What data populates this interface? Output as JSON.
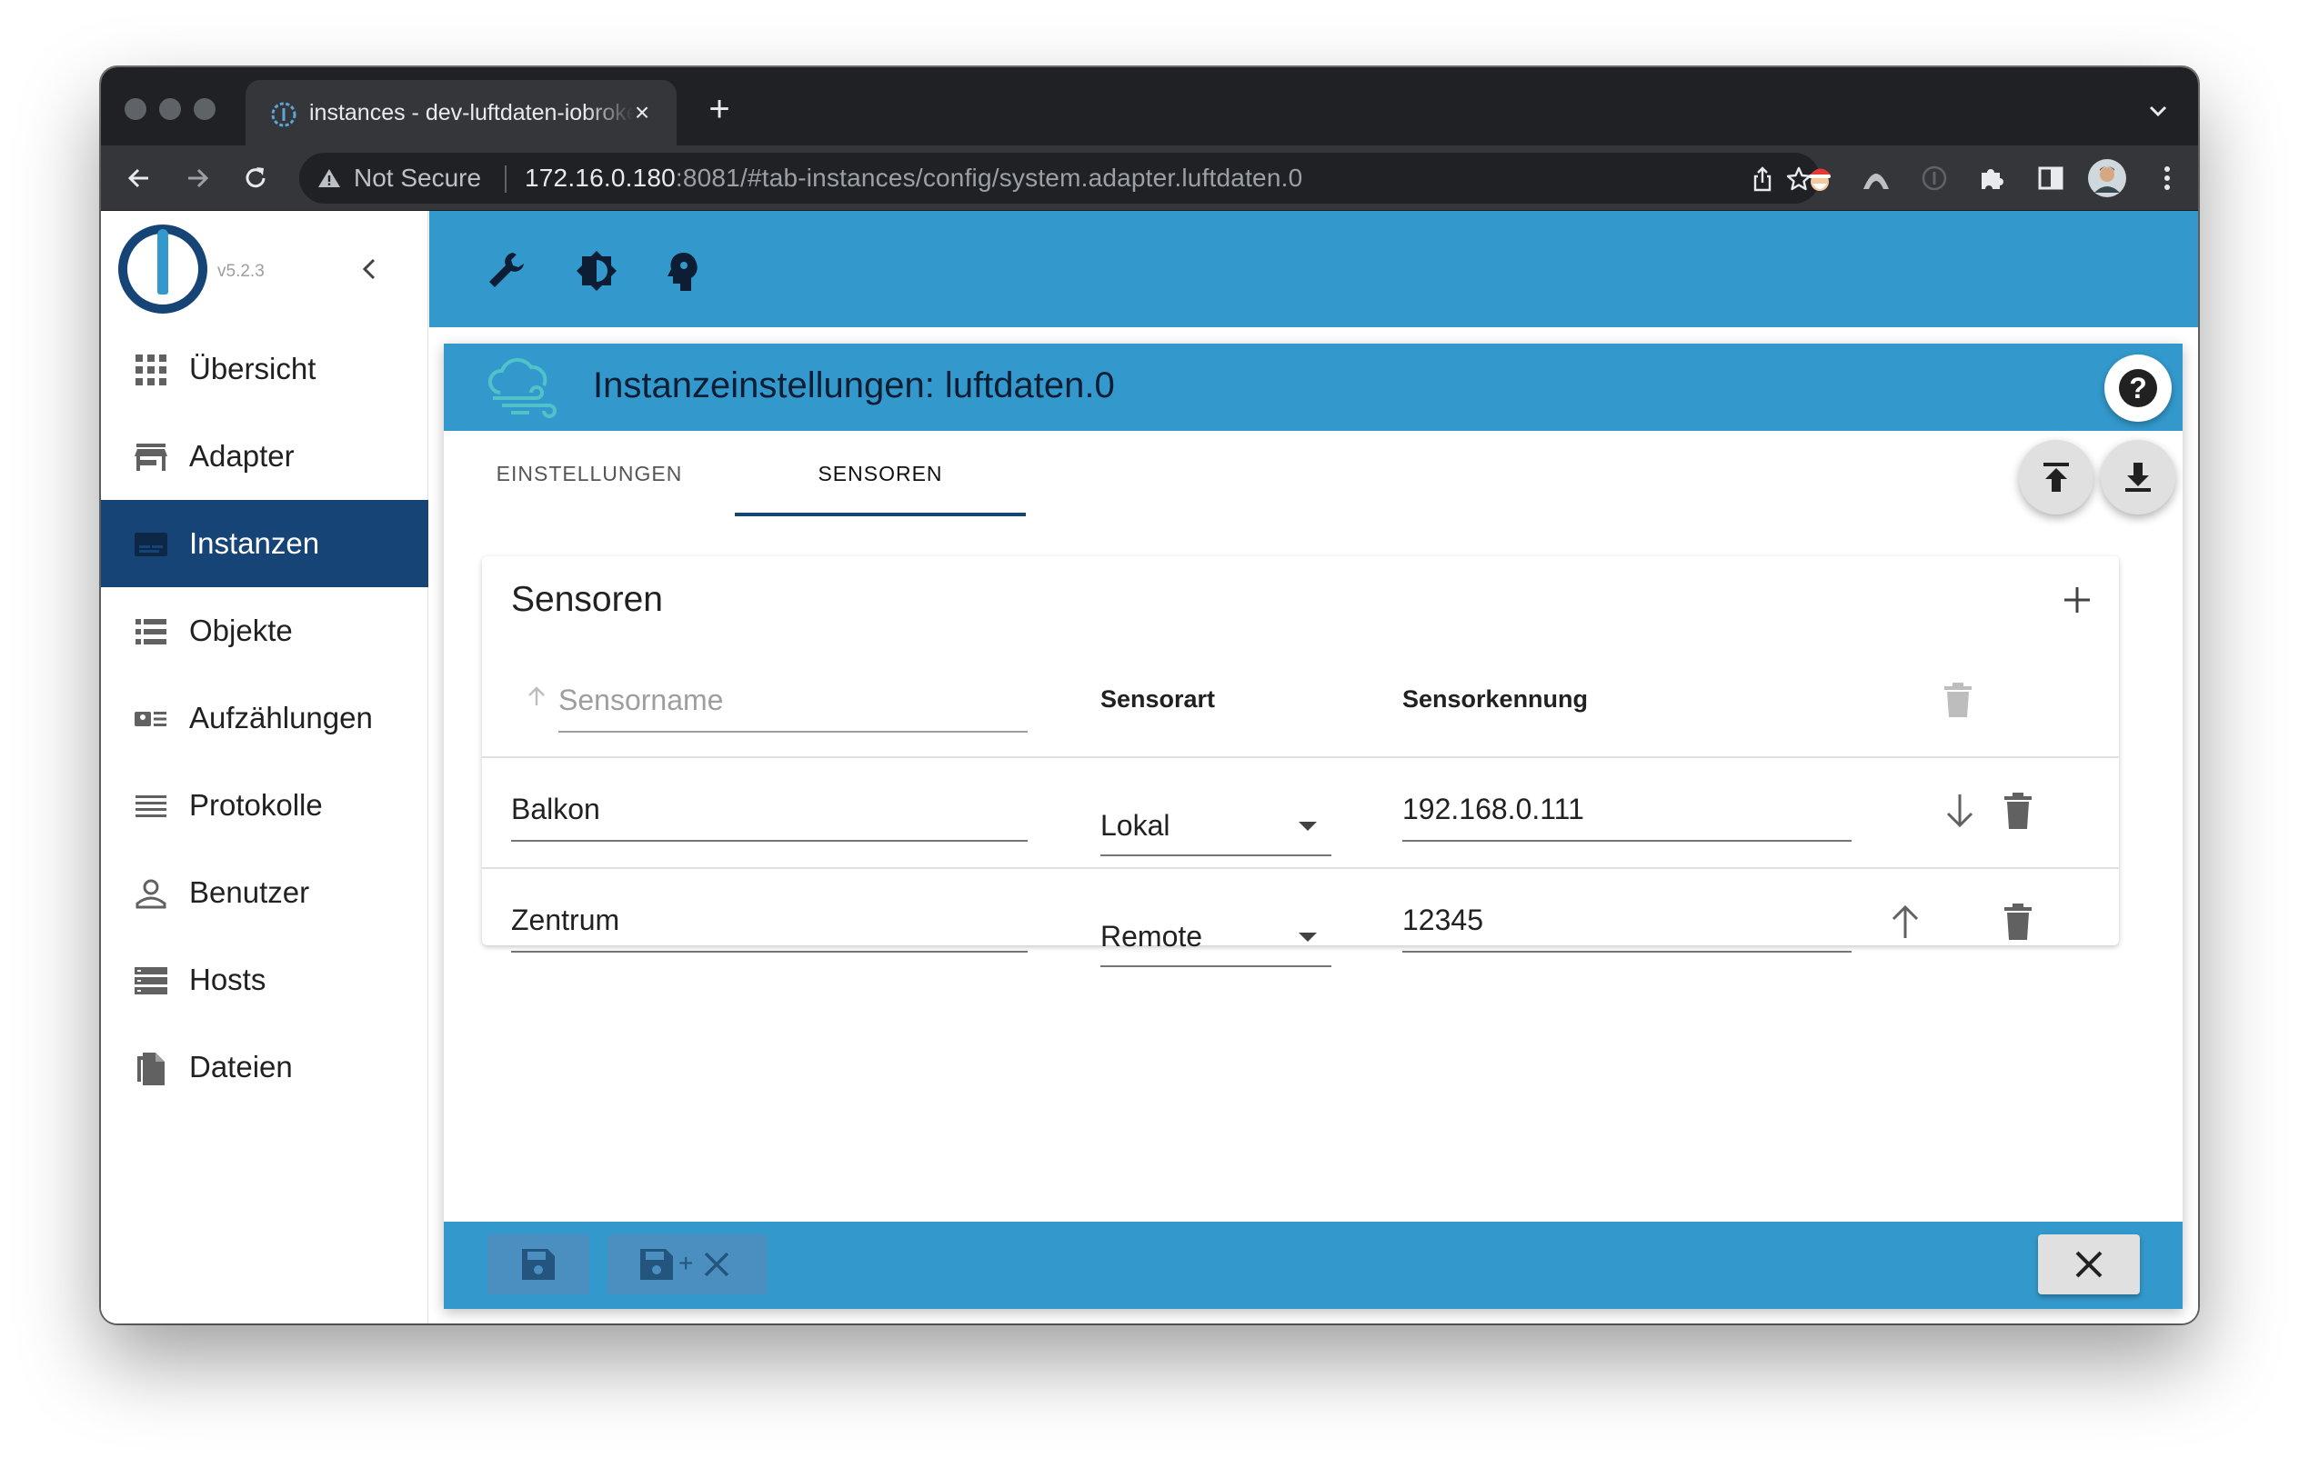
{
  "browser": {
    "tab_title": "instances - dev-luftdaten-iobroker",
    "new_tab_label": "+",
    "security_label": "Not Secure",
    "url_host": "172.16.0.180",
    "url_rest": ":8081/#tab-instances/config/system.adapter.luftdaten.0"
  },
  "app": {
    "version": "v5.2.3",
    "nav": [
      {
        "label": "Übersicht",
        "icon": "grid-icon"
      },
      {
        "label": "Adapter",
        "icon": "store-icon"
      },
      {
        "label": "Instanzen",
        "icon": "instances-icon",
        "active": true
      },
      {
        "label": "Objekte",
        "icon": "list-icon"
      },
      {
        "label": "Aufzählungen",
        "icon": "enum-icon"
      },
      {
        "label": "Protokolle",
        "icon": "log-icon"
      },
      {
        "label": "Benutzer",
        "icon": "user-icon"
      },
      {
        "label": "Hosts",
        "icon": "hosts-icon"
      },
      {
        "label": "Dateien",
        "icon": "files-icon"
      }
    ]
  },
  "dialog": {
    "title": "Instanzeinstellungen: luftdaten.0",
    "help_label": "?",
    "tabs": [
      "EINSTELLUNGEN",
      "SENSOREN"
    ],
    "active_tab": "SENSOREN",
    "card": {
      "title": "Sensoren",
      "name_placeholder": "Sensorname",
      "columns": {
        "type": "Sensorart",
        "id": "Sensorkennung"
      },
      "rows": [
        {
          "name": "Balkon",
          "type": "Lokal",
          "id": "192.168.0.111"
        },
        {
          "name": "Zentrum",
          "type": "Remote",
          "id": "12345"
        }
      ]
    },
    "footer": {
      "save_close_plus": "+"
    }
  },
  "colors": {
    "primary": "#3399cc",
    "sidebar_active": "#164477",
    "chrome_dark": "#202124"
  }
}
